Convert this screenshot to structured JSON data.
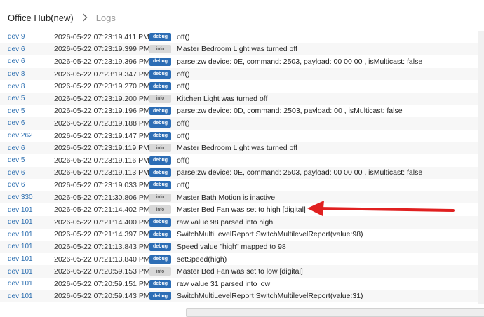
{
  "breadcrumb": {
    "hub": "Office Hub(new)",
    "current": "Logs"
  },
  "colors": {
    "accent": "#2c6db5",
    "arrow": "#e02020",
    "dev_link": "#2d6fb0"
  },
  "icons": {
    "separator": "chevron-right-icon"
  },
  "logs": [
    {
      "dev": "dev:9",
      "time": "2026-05-22 07:23:19.411 PM",
      "level": "debug",
      "msg": "off()"
    },
    {
      "dev": "dev:6",
      "time": "2026-05-22 07:23:19.399 PM",
      "level": "info",
      "msg": "Master Bedroom Light was turned off"
    },
    {
      "dev": "dev:6",
      "time": "2026-05-22 07:23:19.396 PM",
      "level": "debug",
      "msg": "parse:zw device: 0E, command: 2503, payload: 00 00 00 , isMulticast: false"
    },
    {
      "dev": "dev:8",
      "time": "2026-05-22 07:23:19.347 PM",
      "level": "debug",
      "msg": "off()"
    },
    {
      "dev": "dev:8",
      "time": "2026-05-22 07:23:19.270 PM",
      "level": "debug",
      "msg": "off()"
    },
    {
      "dev": "dev:5",
      "time": "2026-05-22 07:23:19.200 PM",
      "level": "info",
      "msg": "Kitchen Light was turned off"
    },
    {
      "dev": "dev:5",
      "time": "2026-05-22 07:23:19.196 PM",
      "level": "debug",
      "msg": "parse:zw device: 0D, command: 2503, payload: 00 , isMulticast: false"
    },
    {
      "dev": "dev:6",
      "time": "2026-05-22 07:23:19.188 PM",
      "level": "debug",
      "msg": "off()"
    },
    {
      "dev": "dev:262",
      "time": "2026-05-22 07:23:19.147 PM",
      "level": "debug",
      "msg": "off()"
    },
    {
      "dev": "dev:6",
      "time": "2026-05-22 07:23:19.119 PM",
      "level": "info",
      "msg": "Master Bedroom Light was turned off"
    },
    {
      "dev": "dev:5",
      "time": "2026-05-22 07:23:19.116 PM",
      "level": "debug",
      "msg": "off()"
    },
    {
      "dev": "dev:6",
      "time": "2026-05-22 07:23:19.113 PM",
      "level": "debug",
      "msg": "parse:zw device: 0E, command: 2503, payload: 00 00 00 , isMulticast: false"
    },
    {
      "dev": "dev:6",
      "time": "2026-05-22 07:23:19.033 PM",
      "level": "debug",
      "msg": "off()"
    },
    {
      "dev": "dev:330",
      "time": "2026-05-22 07:21:30.806 PM",
      "level": "info",
      "msg": "Master Bath Motion is inactive"
    },
    {
      "dev": "dev:101",
      "time": "2026-05-22 07:21:14.402 PM",
      "level": "info",
      "msg": "Master Bed Fan was set to high [digital]"
    },
    {
      "dev": "dev:101",
      "time": "2026-05-22 07:21:14.400 PM",
      "level": "debug",
      "msg": "raw value 98 parsed into high"
    },
    {
      "dev": "dev:101",
      "time": "2026-05-22 07:21:14.397 PM",
      "level": "debug",
      "msg": "SwitchMultiLevelReport SwitchMultilevelReport(value:98)"
    },
    {
      "dev": "dev:101",
      "time": "2026-05-22 07:21:13.843 PM",
      "level": "debug",
      "msg": "Speed value \"high\" mapped to 98"
    },
    {
      "dev": "dev:101",
      "time": "2026-05-22 07:21:13.840 PM",
      "level": "debug",
      "msg": "setSpeed(high)"
    },
    {
      "dev": "dev:101",
      "time": "2026-05-22 07:20:59.153 PM",
      "level": "info",
      "msg": "Master Bed Fan was set to low [digital]"
    },
    {
      "dev": "dev:101",
      "time": "2026-05-22 07:20:59.151 PM",
      "level": "debug",
      "msg": "raw value 31 parsed into low"
    },
    {
      "dev": "dev:101",
      "time": "2026-05-22 07:20:59.143 PM",
      "level": "debug",
      "msg": "SwitchMultiLevelReport SwitchMultilevelReport(value:31)"
    }
  ]
}
